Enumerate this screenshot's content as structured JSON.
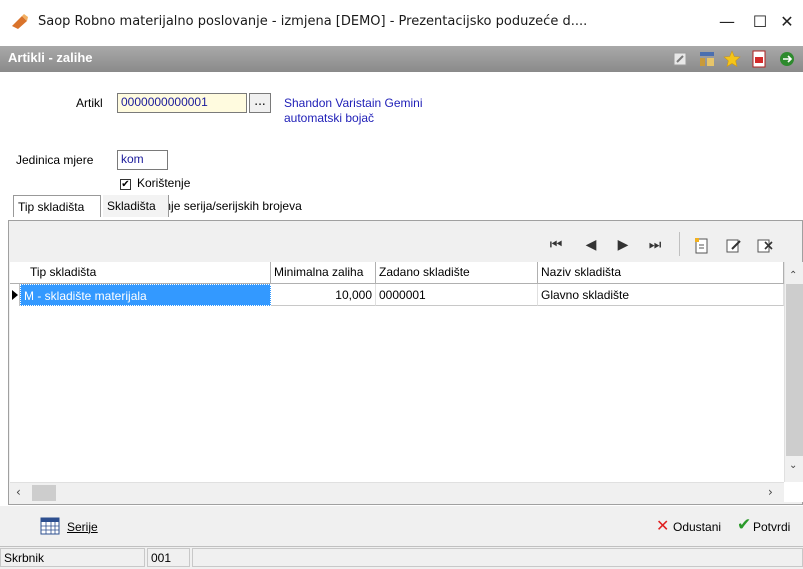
{
  "window": {
    "title": "Saop Robno materijalno poslovanje - izmjena  [DEMO] - Prezentacijsko poduzeće d....",
    "minimize": "—",
    "maximize": "☐",
    "close": "✕"
  },
  "header": {
    "title": "Artikli - zalihe",
    "icons": [
      "edit-icon",
      "hierarchy-icon",
      "star-icon",
      "pdf-icon",
      "exit-icon"
    ]
  },
  "form": {
    "artikl_label": "Artikl",
    "artikl_value": "0000000000001",
    "lookup_button": "...",
    "artikl_description_line1": "Shandon Varistain Gemini",
    "artikl_description_line2": "automatski bojač",
    "jedinica_label": "Jedinica mjere",
    "jedinica_value": "kom",
    "koristenje_label": "Korištenje",
    "koristenje_checked": true,
    "serije_label": "Vođenje serija/serijskih brojeva",
    "serije_checked": true
  },
  "tabs": [
    {
      "label": "Tip skladišta",
      "active": true
    },
    {
      "label": "Skladišta",
      "active": false
    }
  ],
  "grid": {
    "columns": [
      "Tip skladišta",
      "Minimalna zaliha",
      "Zadano skladište",
      "Naziv skladišta"
    ],
    "rows": [
      {
        "tip": "M - skladište materijala",
        "min_zaliha": "10,000",
        "zadano": "0000001",
        "naziv": "Glavno skladište",
        "selected": true
      }
    ]
  },
  "footer": {
    "serije_button": "Serije",
    "odustani_button": "Odustani",
    "potvrdi_button": "Potvrdi"
  },
  "status": {
    "label": "Skrbnik",
    "value": "001",
    "extra": ""
  },
  "colors": {
    "accent": "#3399ff",
    "selection": "#3399ff",
    "desc_text": "#2121b8",
    "cancel": "#e02020",
    "confirm": "#2a9a2a"
  }
}
